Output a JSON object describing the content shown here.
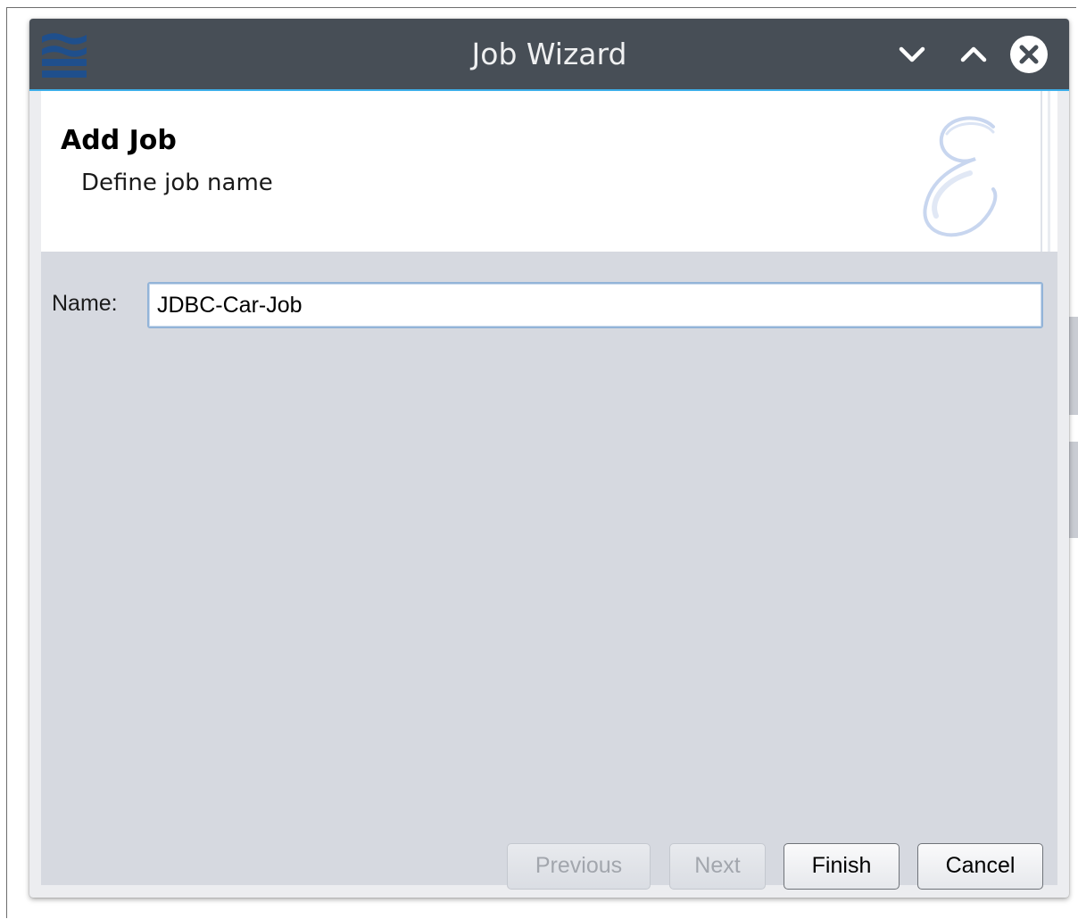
{
  "window": {
    "title": "Job Wizard",
    "app_icon": "app-logo-icon",
    "controls": {
      "minimize_icon": "chevron-down-icon",
      "maximize_icon": "chevron-up-icon",
      "close_icon": "close-circle-icon"
    },
    "titlebar_color": "#474e56",
    "accent_color": "#3daee9"
  },
  "header": {
    "title": "Add Job",
    "subtitle": "Define job name",
    "watermark_icon": "script-e-watermark-icon"
  },
  "form": {
    "name_label": "Name:",
    "name_value": "JDBC-Car-Job"
  },
  "buttons": {
    "previous": "Previous",
    "next": "Next",
    "finish": "Finish",
    "cancel": "Cancel"
  }
}
